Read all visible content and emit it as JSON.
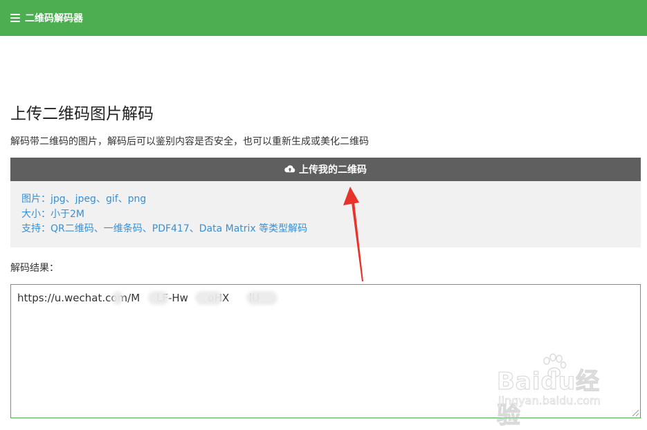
{
  "header": {
    "menu_icon": "hamburger-menu-icon",
    "title": "二维码解码器",
    "background_color": "#4cae50"
  },
  "main": {
    "title": "上传二维码图片解码",
    "description": "解码带二维码的图片，解码后可以鉴别内容是否安全，也可以重新生成或美化二维码",
    "upload_button": {
      "icon": "cloud-upload-icon",
      "label": "上传我的二维码",
      "background_color": "#5f5f5f"
    },
    "info": [
      "图片：jpg、jpeg、gif、png",
      "大小：小于2M",
      "支持：QR二维码、一维条码、PDF417、Data Matrix 等类型解码"
    ],
    "info_color": "#3a8fd0",
    "result_label": "解码结果：",
    "result_value": "https://u.wechat.com/M     LF-Hw      oHX      lU"
  },
  "watermark": {
    "brand": "Baidu经验",
    "domain": "jingyan.baidu.com"
  }
}
